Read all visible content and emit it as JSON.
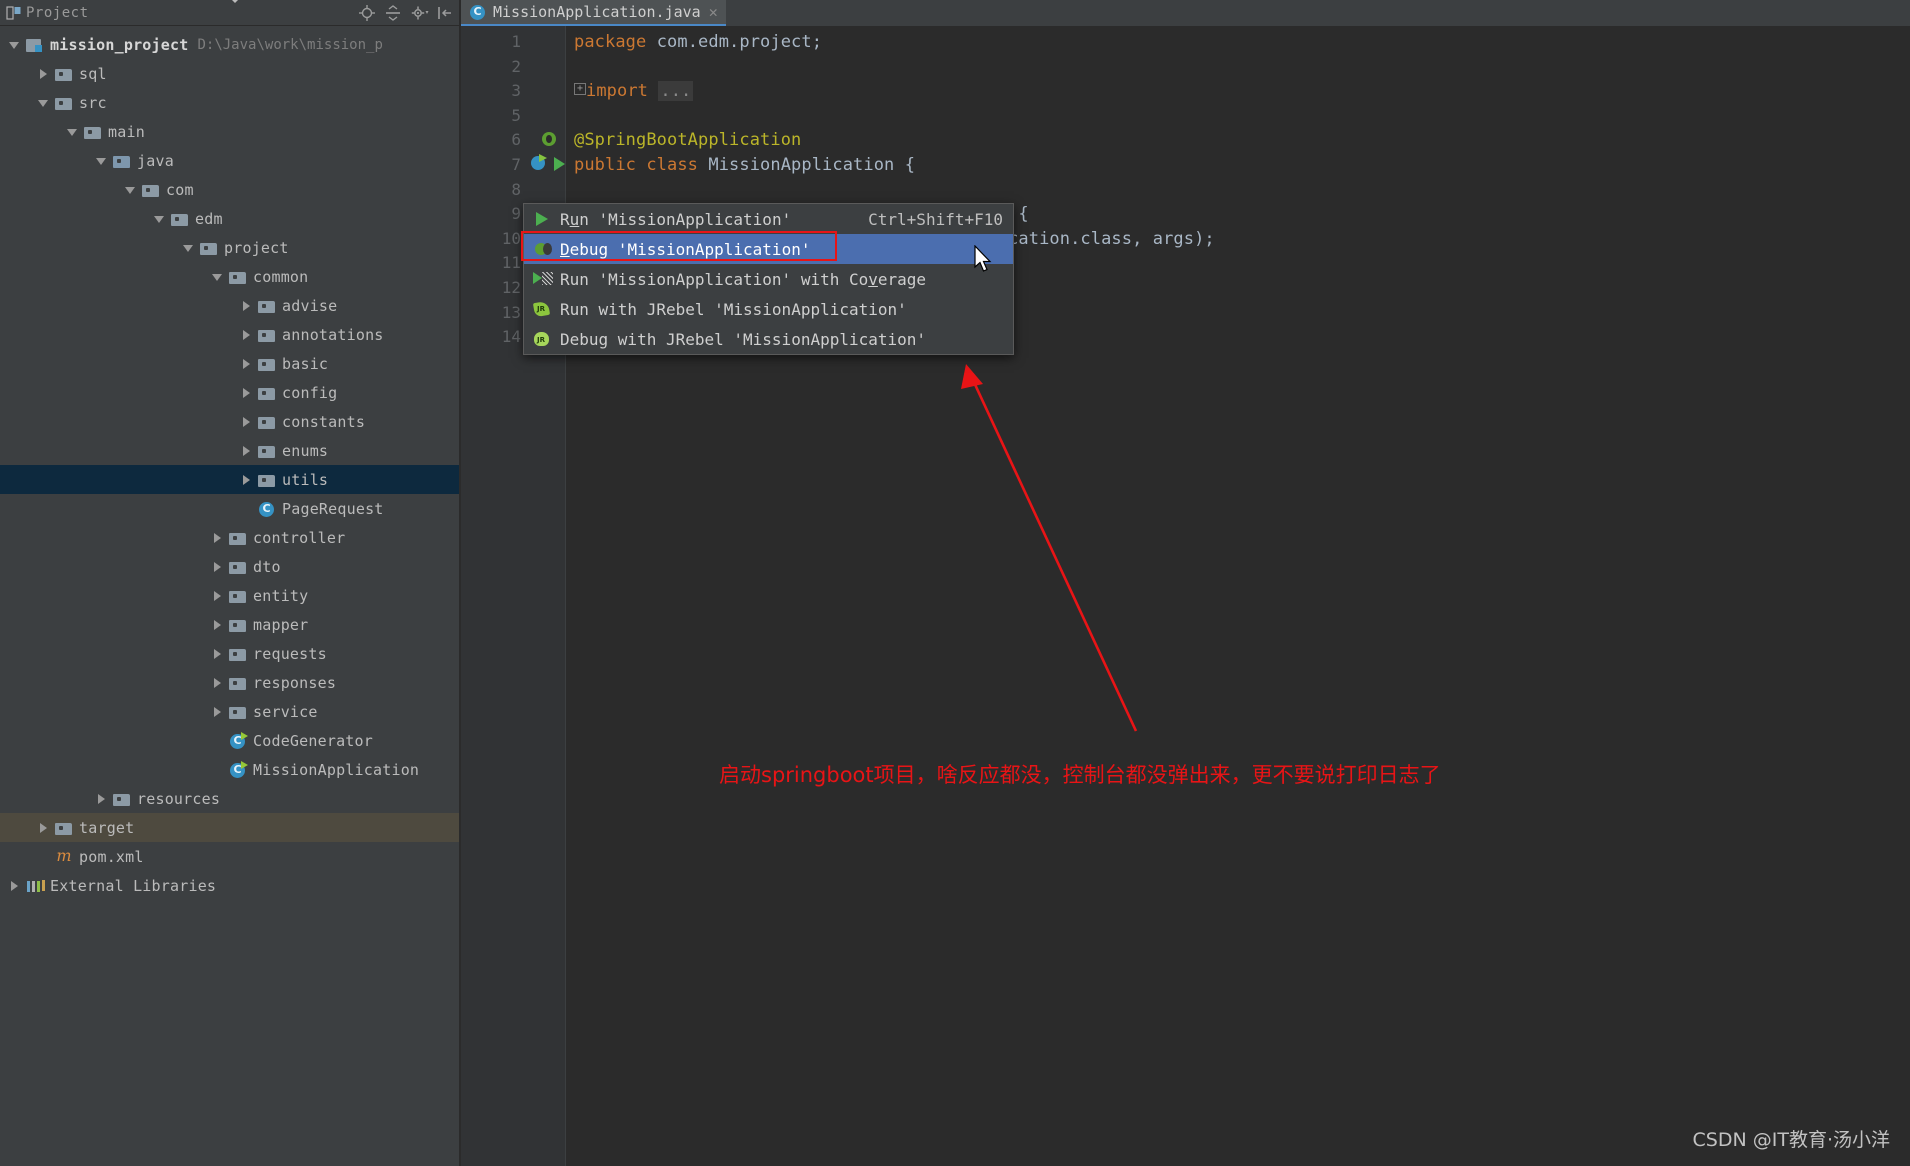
{
  "window": {
    "app": "IntelliJ IDEA",
    "background_color": "#2b2b2b"
  },
  "project_panel": {
    "title": "Project",
    "title_icon": "project-view-icon",
    "dropdown_icon": "chevron-down-icon",
    "toolbar_icons": [
      "locate-icon",
      "collapse-all-icon",
      "settings-gear-icon",
      "hide-panel-icon"
    ],
    "tree": [
      {
        "label": "mission_project",
        "path": "D:\\Java\\work\\mission_p",
        "icon": "module-icon",
        "arrow": "open",
        "indent": 0,
        "bold": true,
        "state": "normal"
      },
      {
        "label": "sql",
        "icon": "folder-icon",
        "arrow": "closed",
        "indent": 1,
        "state": "normal"
      },
      {
        "label": "src",
        "icon": "folder-icon",
        "arrow": "open",
        "indent": 1,
        "state": "normal"
      },
      {
        "label": "main",
        "icon": "folder-icon",
        "arrow": "open",
        "indent": 2,
        "state": "normal"
      },
      {
        "label": "java",
        "icon": "source-folder-icon",
        "arrow": "open",
        "indent": 3,
        "state": "normal"
      },
      {
        "label": "com",
        "icon": "folder-icon",
        "arrow": "open",
        "indent": 4,
        "state": "normal"
      },
      {
        "label": "edm",
        "icon": "folder-icon",
        "arrow": "open",
        "indent": 5,
        "state": "normal"
      },
      {
        "label": "project",
        "icon": "folder-icon",
        "arrow": "open",
        "indent": 6,
        "state": "normal"
      },
      {
        "label": "common",
        "icon": "folder-icon",
        "arrow": "open",
        "indent": 7,
        "state": "normal"
      },
      {
        "label": "advise",
        "icon": "folder-icon",
        "arrow": "closed",
        "indent": 8,
        "state": "normal"
      },
      {
        "label": "annotations",
        "icon": "folder-icon",
        "arrow": "closed",
        "indent": 8,
        "state": "normal"
      },
      {
        "label": "basic",
        "icon": "folder-icon",
        "arrow": "closed",
        "indent": 8,
        "state": "normal"
      },
      {
        "label": "config",
        "icon": "folder-icon",
        "arrow": "closed",
        "indent": 8,
        "state": "normal"
      },
      {
        "label": "constants",
        "icon": "folder-icon",
        "arrow": "closed",
        "indent": 8,
        "state": "normal"
      },
      {
        "label": "enums",
        "icon": "folder-icon",
        "arrow": "closed",
        "indent": 8,
        "state": "normal"
      },
      {
        "label": "utils",
        "icon": "folder-icon",
        "arrow": "closed",
        "indent": 8,
        "state": "selected"
      },
      {
        "label": "PageRequest",
        "icon": "java-class-icon",
        "arrow": "none",
        "indent": 8,
        "state": "normal"
      },
      {
        "label": "controller",
        "icon": "folder-icon",
        "arrow": "closed",
        "indent": 7,
        "state": "normal"
      },
      {
        "label": "dto",
        "icon": "folder-icon",
        "arrow": "closed",
        "indent": 7,
        "state": "normal"
      },
      {
        "label": "entity",
        "icon": "folder-icon",
        "arrow": "closed",
        "indent": 7,
        "state": "normal"
      },
      {
        "label": "mapper",
        "icon": "folder-icon",
        "arrow": "closed",
        "indent": 7,
        "state": "normal"
      },
      {
        "label": "requests",
        "icon": "folder-icon",
        "arrow": "closed",
        "indent": 7,
        "state": "normal"
      },
      {
        "label": "responses",
        "icon": "folder-icon",
        "arrow": "closed",
        "indent": 7,
        "state": "normal"
      },
      {
        "label": "service",
        "icon": "folder-icon",
        "arrow": "closed",
        "indent": 7,
        "state": "normal"
      },
      {
        "label": "CodeGenerator",
        "icon": "java-runnable-class-icon",
        "arrow": "none",
        "indent": 7,
        "state": "normal"
      },
      {
        "label": "MissionApplication",
        "icon": "java-runnable-class-icon",
        "arrow": "none",
        "indent": 7,
        "state": "normal"
      },
      {
        "label": "resources",
        "icon": "resources-folder-icon",
        "arrow": "closed",
        "indent": 3,
        "state": "normal"
      },
      {
        "label": "target",
        "icon": "target-folder-icon",
        "arrow": "closed",
        "indent": 1,
        "state": "dim-selected"
      },
      {
        "label": "pom.xml",
        "icon": "maven-xml-icon",
        "arrow": "none",
        "indent": 1,
        "state": "normal"
      },
      {
        "label": "External Libraries",
        "icon": "libraries-icon",
        "arrow": "closed",
        "indent": 0,
        "state": "normal"
      }
    ]
  },
  "editor": {
    "tab": {
      "label": "MissionApplication.java",
      "icon": "java-class-icon",
      "close_icon": "close-icon"
    },
    "lines": [
      {
        "num": "1",
        "segments": [
          {
            "t": "package ",
            "c": "kw"
          },
          {
            "t": "com.edm.project;",
            "c": "plain"
          }
        ],
        "gutter": null
      },
      {
        "num": "2",
        "segments": [],
        "gutter": null
      },
      {
        "num": "3",
        "segments": [
          {
            "t": "import ",
            "c": "kw",
            "fold": true
          },
          {
            "t": "...",
            "c": "chip"
          }
        ],
        "gutter": null
      },
      {
        "num": "5",
        "segments": [],
        "gutter": null
      },
      {
        "num": "6",
        "segments": [
          {
            "t": "@SpringBootApplication",
            "c": "ann"
          }
        ],
        "gutter": "spring-bean-icon"
      },
      {
        "num": "7",
        "segments": [
          {
            "t": "public class ",
            "c": "kw"
          },
          {
            "t": "MissionApplication {",
            "c": "plain"
          }
        ],
        "gutter": "runnable-class-icon"
      },
      {
        "num": "8",
        "segments": [],
        "gutter": null
      },
      {
        "num": "9",
        "segments": [
          {
            "t": "    public static void main(String[] args) {",
            "c": "plain"
          }
        ],
        "gutter": "run-method-icon"
      },
      {
        "num": "10",
        "segments": [
          {
            "t": "        SpringApplication.run(MissionApplication.class, args);",
            "c": "plain"
          }
        ],
        "gutter": null
      },
      {
        "num": "11",
        "segments": [
          {
            "t": "    }",
            "c": "plain"
          }
        ],
        "gutter": null
      },
      {
        "num": "12",
        "segments": [],
        "gutter": null
      },
      {
        "num": "13",
        "segments": [
          {
            "t": "}",
            "c": "plain"
          }
        ],
        "gutter": null
      },
      {
        "num": "14",
        "segments": [],
        "gutter": null
      }
    ]
  },
  "context_menu": {
    "items": [
      {
        "label": "Run 'MissionApplication'",
        "mnemonic": "u",
        "shortcut": "Ctrl+Shift+F10",
        "icon": "run-icon",
        "highlighted": false
      },
      {
        "label": "Debug 'MissionApplication'",
        "mnemonic": "D",
        "shortcut": "",
        "icon": "debug-icon",
        "highlighted": true
      },
      {
        "label": "Run 'MissionApplication' with Coverage",
        "mnemonic": "v",
        "shortcut": "",
        "icon": "run-coverage-icon",
        "highlighted": false
      },
      {
        "label": "Run with JRebel 'MissionApplication'",
        "mnemonic": "",
        "shortcut": "",
        "icon": "jrebel-run-icon",
        "highlighted": false
      },
      {
        "label": "Debug with JRebel 'MissionApplication'",
        "mnemonic": "",
        "shortcut": "",
        "icon": "jrebel-debug-icon",
        "highlighted": false
      }
    ]
  },
  "annotation": {
    "text": "启动springboot项目，啥反应都没，控制台都没弹出来，更不要说打印日志了",
    "color": "#e81416",
    "arrow_icon": "red-arrow-annotation",
    "highlight_box_color": "#e81416"
  },
  "cursor": {
    "icon": "mouse-pointer-icon"
  },
  "watermark": {
    "text": "CSDN @IT教育·汤小洋"
  }
}
